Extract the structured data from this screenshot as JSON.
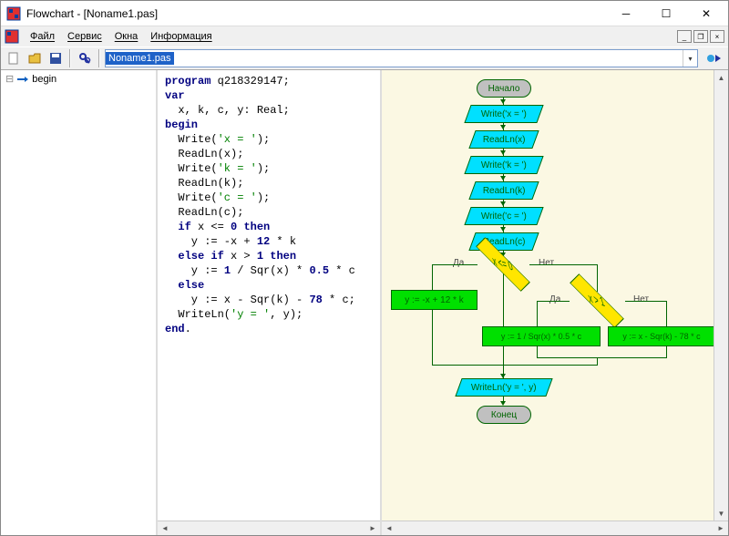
{
  "window": {
    "title": "Flowchart - [Noname1.pas]"
  },
  "menubar": {
    "items": [
      "Файл",
      "Сервис",
      "Окна",
      "Информация"
    ]
  },
  "file_combo": {
    "selected": "Noname1.pas"
  },
  "tree": {
    "root": {
      "label": "begin"
    }
  },
  "code": {
    "lines": [
      {
        "t": "kw",
        "txt": "program"
      },
      {
        "txt": " q218329147;"
      },
      {
        "br": true
      },
      {
        "t": "kw",
        "txt": "var"
      },
      {
        "br": true
      },
      {
        "txt": "  x, k, c, y: Real;"
      },
      {
        "br": true
      },
      {
        "t": "kw",
        "txt": "begin"
      },
      {
        "br": true
      },
      {
        "txt": "  Write("
      },
      {
        "t": "str",
        "txt": "'x = '"
      },
      {
        "txt": ");"
      },
      {
        "br": true
      },
      {
        "txt": "  ReadLn(x);"
      },
      {
        "br": true
      },
      {
        "txt": "  Write("
      },
      {
        "t": "str",
        "txt": "'k = '"
      },
      {
        "txt": ");"
      },
      {
        "br": true
      },
      {
        "txt": "  ReadLn(k);"
      },
      {
        "br": true
      },
      {
        "txt": "  Write("
      },
      {
        "t": "str",
        "txt": "'c = '"
      },
      {
        "txt": ");"
      },
      {
        "br": true
      },
      {
        "txt": "  ReadLn(c);"
      },
      {
        "br": true
      },
      {
        "txt": "  "
      },
      {
        "t": "kw",
        "txt": "if"
      },
      {
        "txt": " x <= "
      },
      {
        "t": "num",
        "txt": "0"
      },
      {
        "txt": " "
      },
      {
        "t": "kw",
        "txt": "then"
      },
      {
        "br": true
      },
      {
        "txt": "    y := -x + "
      },
      {
        "t": "num",
        "txt": "12"
      },
      {
        "txt": " * k"
      },
      {
        "br": true
      },
      {
        "txt": "  "
      },
      {
        "t": "kw",
        "txt": "else if"
      },
      {
        "txt": " x > "
      },
      {
        "t": "num",
        "txt": "1"
      },
      {
        "txt": " "
      },
      {
        "t": "kw",
        "txt": "then"
      },
      {
        "br": true
      },
      {
        "txt": "    y := "
      },
      {
        "t": "num",
        "txt": "1"
      },
      {
        "txt": " / Sqr(x) * "
      },
      {
        "t": "num",
        "txt": "0.5"
      },
      {
        "txt": " * c"
      },
      {
        "br": true
      },
      {
        "txt": "  "
      },
      {
        "t": "kw",
        "txt": "else"
      },
      {
        "br": true
      },
      {
        "txt": "    y := x - Sqr(k) - "
      },
      {
        "t": "num",
        "txt": "78"
      },
      {
        "txt": " * c;"
      },
      {
        "br": true
      },
      {
        "txt": "  WriteLn("
      },
      {
        "t": "str",
        "txt": "'y = '"
      },
      {
        "txt": ", y);"
      },
      {
        "br": true
      },
      {
        "t": "kw",
        "txt": "end"
      },
      {
        "txt": "."
      }
    ]
  },
  "flowchart": {
    "start": "Начало",
    "end": "Конец",
    "io": {
      "wx": "Write('x = ')",
      "rx": "ReadLn(x)",
      "wk": "Write('k = ')",
      "rk": "ReadLn(k)",
      "wc": "Write('c = ')",
      "rc": "ReadLn(c)",
      "wy": "WriteLn('y = ', y)"
    },
    "cond1": "x <= 0",
    "cond2": "x > 1",
    "proc": {
      "p1": "y := -x + 12 * k",
      "p2": "y := 1 / Sqr(x) * 0.5 * c",
      "p3": "y := x - Sqr(k) - 78 * c"
    },
    "labels": {
      "yes": "Да",
      "no": "Нет"
    }
  }
}
